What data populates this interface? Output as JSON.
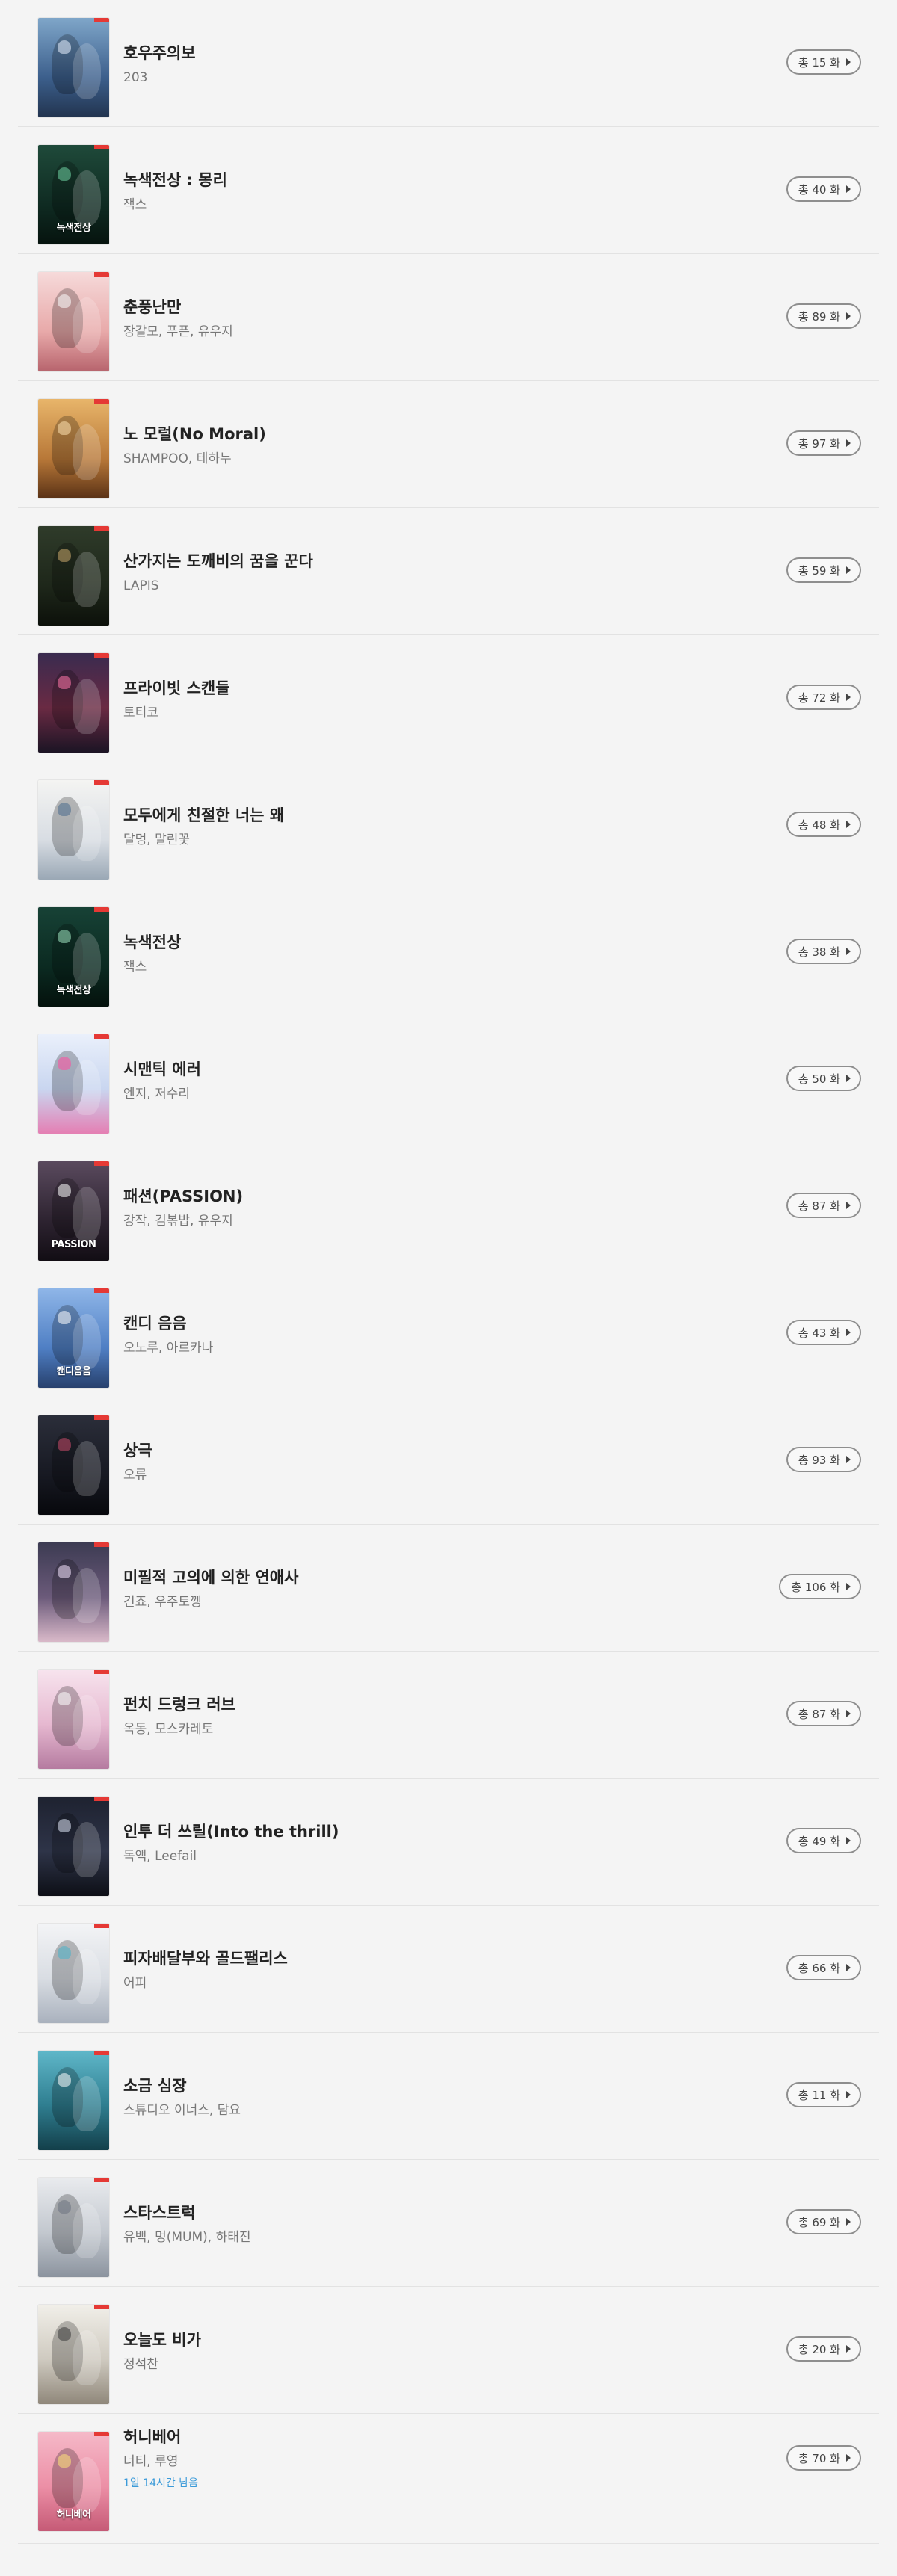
{
  "items": [
    {
      "title": "호우주의보",
      "author": "203",
      "episodes": "총 15 화",
      "cover": {
        "bg": "linear-gradient(180deg,#7fa6c9 0%,#3c5f8c 60%,#22344f 100%)",
        "accent": "#e8f0ff",
        "cover_text": ""
      }
    },
    {
      "title": "녹색전상 : 몽리",
      "author": "잭스",
      "episodes": "총 40 화",
      "cover": {
        "bg": "linear-gradient(180deg,#1f4a3a 0%,#0f2b22 60%,#06130e 100%)",
        "accent": "#6fd3a4",
        "cover_text": "녹색전상"
      }
    },
    {
      "title": "춘풍난만",
      "author": "장갈모, 푸픈, 유우지",
      "episodes": "총 89 화",
      "cover": {
        "bg": "linear-gradient(180deg,#f6dada 0%,#e8a9a9 60%,#b7646d 100%)",
        "accent": "#ffffff",
        "cover_text": ""
      }
    },
    {
      "title": "노 모럴(No Moral)",
      "author": "SHAMPOO, 테하누",
      "episodes": "총 97 화",
      "cover": {
        "bg": "linear-gradient(180deg,#e8b56a 0%,#b87838 60%,#5a3216 100%)",
        "accent": "#ffe2b0",
        "cover_text": ""
      }
    },
    {
      "title": "산가지는 도깨비의 꿈을 꾼다",
      "author": "LAPIS",
      "episodes": "총 59 화",
      "cover": {
        "bg": "linear-gradient(180deg,#2f3b2a 0%,#1e271a 60%,#0c100a 100%)",
        "accent": "#c9a86b",
        "cover_text": ""
      }
    },
    {
      "title": "프라이빗 스캔들",
      "author": "토티코",
      "episodes": "총 72 화",
      "cover": {
        "bg": "linear-gradient(180deg,#3a2b4f 0%,#6a2a43 55%,#1b1424 100%)",
        "accent": "#ff77aa",
        "cover_text": ""
      }
    },
    {
      "title": "모두에게 친절한 너는 왜",
      "author": "달멍, 말린꽃",
      "episodes": "총 48 화",
      "cover": {
        "bg": "linear-gradient(180deg,#f4f4f2 0%,#d8dde3 60%,#9aa8b5 100%)",
        "accent": "#4b6b8c",
        "cover_text": ""
      }
    },
    {
      "title": "녹색전상",
      "author": "잭스",
      "episodes": "총 38 화",
      "cover": {
        "bg": "linear-gradient(180deg,#174236 0%,#0b2a21 60%,#04110c 100%)",
        "accent": "#9fe3c0",
        "cover_text": "녹색전상"
      }
    },
    {
      "title": "시맨틱 에러",
      "author": "엔지, 저수리",
      "episodes": "총 50 화",
      "cover": {
        "bg": "linear-gradient(180deg,#eaf0fb 0%,#c9d6f0 55%,#e47fb3 100%)",
        "accent": "#ff4fa0",
        "cover_text": ""
      }
    },
    {
      "title": "패션(PASSION)",
      "author": "강작, 김볶밥, 유우지",
      "episodes": "총 87 화",
      "cover": {
        "bg": "linear-gradient(180deg,#5a4a5e 0%,#2d2330 60%,#120d14 100%)",
        "accent": "#ffffff",
        "cover_text": "PASSION"
      }
    },
    {
      "title": "캔디 음음",
      "author": "오노루, 아르카나",
      "episodes": "총 43 화",
      "cover": {
        "bg": "linear-gradient(180deg,#8fb6e8 0%,#4f7fc4 60%,#27406d 100%)",
        "accent": "#ffffff",
        "cover_text": "캔디음음"
      }
    },
    {
      "title": "상극",
      "author": "오류",
      "episodes": "총 93 화",
      "cover": {
        "bg": "linear-gradient(180deg,#2b2e3a 0%,#171922 60%,#07080c 100%)",
        "accent": "#c94a6a",
        "cover_text": ""
      }
    },
    {
      "title": "미필적 고의에 의한 연애사",
      "author": "긴죠, 우주토껭",
      "episodes": "총 106 화",
      "cover": {
        "bg": "linear-gradient(180deg,#3c3b52 0%,#6b5a7a 55%,#d9b9c9 100%)",
        "accent": "#f5e6ff",
        "cover_text": ""
      }
    },
    {
      "title": "펀치 드렁크 러브",
      "author": "옥동, 모스카레토",
      "episodes": "총 87 화",
      "cover": {
        "bg": "linear-gradient(180deg,#f7e4ee 0%,#e6b8d0 55%,#b57ba0 100%)",
        "accent": "#ffffff",
        "cover_text": ""
      }
    },
    {
      "title": "인투 더 쓰릴(Into the thrill)",
      "author": "독액, Leefail",
      "episodes": "총 49 화",
      "cover": {
        "bg": "linear-gradient(180deg,#1e2230 0%,#2e3448 55%,#0d0f16 100%)",
        "accent": "#dfe6f5",
        "cover_text": ""
      }
    },
    {
      "title": "피자배달부와 골드팰리스",
      "author": "어피",
      "episodes": "총 66 화",
      "cover": {
        "bg": "linear-gradient(180deg,#f3f4f6 0%,#d9dde3 55%,#a9b1bd 100%)",
        "accent": "#4ab3c9",
        "cover_text": ""
      }
    },
    {
      "title": "소금 심장",
      "author": "스튜디오 이너스, 담요",
      "episodes": "총 11 화",
      "cover": {
        "bg": "linear-gradient(180deg,#5fb7c9 0%,#2f7e90 55%,#133f4a 100%)",
        "accent": "#ffffff",
        "cover_text": ""
      }
    },
    {
      "title": "스타스트럭",
      "author": "유백, 멍(MUM), 하태진",
      "episodes": "총 69 화",
      "cover": {
        "bg": "linear-gradient(180deg,#e9ebee 0%,#c3c8cf 55%,#8b939e 100%)",
        "accent": "#6b7380",
        "cover_text": ""
      }
    },
    {
      "title": "오늘도 비가",
      "author": "정석찬",
      "episodes": "총 20 화",
      "cover": {
        "bg": "linear-gradient(180deg,#f1efe9 0%,#cfcac0 55%,#8f877a 100%)",
        "accent": "#3a3a3a",
        "cover_text": ""
      }
    },
    {
      "title": "허니베어",
      "author": "너티, 루영",
      "remain": "1일 14시간 남음",
      "episodes": "총 70 화",
      "cover": {
        "bg": "linear-gradient(180deg,#f5b9c8 0%,#ec8fa6 55%,#c55a76 100%)",
        "accent": "#ffe37a",
        "cover_text": "허니베어"
      }
    }
  ]
}
